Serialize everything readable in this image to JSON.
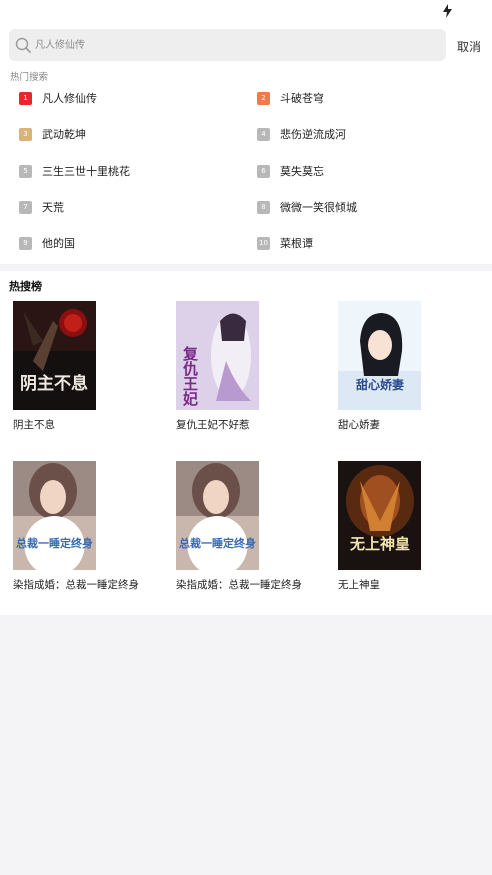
{
  "search": {
    "placeholder": "凡人修仙传",
    "cancel_label": "取消"
  },
  "hot_search": {
    "title": "热门搜索",
    "items": [
      {
        "rank": "1",
        "label": "凡人修仙传",
        "color": "#e8262c"
      },
      {
        "rank": "2",
        "label": "斗破苍穹",
        "color": "#f07a4a"
      },
      {
        "rank": "3",
        "label": "武动乾坤",
        "color": "#d9b27c"
      },
      {
        "rank": "4",
        "label": "悲伤逆流成河",
        "color": "#b8b8b8"
      },
      {
        "rank": "5",
        "label": "三生三世十里桃花",
        "color": "#b8b8b8"
      },
      {
        "rank": "6",
        "label": "莫失莫忘",
        "color": "#b8b8b8"
      },
      {
        "rank": "7",
        "label": "天荒",
        "color": "#b8b8b8"
      },
      {
        "rank": "8",
        "label": "微微一笑很倾城",
        "color": "#b8b8b8"
      },
      {
        "rank": "9",
        "label": "他的国",
        "color": "#b8b8b8"
      },
      {
        "rank": "10",
        "label": "菜根谭",
        "color": "#b8b8b8"
      }
    ]
  },
  "hot_list": {
    "title": "热搜榜",
    "books": [
      {
        "title": "阴主不息",
        "cover_text": "阴主不息"
      },
      {
        "title": "复仇王妃不好惹",
        "cover_text": "复仇王妃"
      },
      {
        "title": "甜心娇妻",
        "cover_text": "甜心娇妻"
      },
      {
        "title": "染指成婚：总裁一睡定终身",
        "cover_text": "总裁一睡定终身"
      },
      {
        "title": "染指成婚：总裁一睡定终身",
        "cover_text": "总裁一睡定终身"
      },
      {
        "title": "无上神皇",
        "cover_text": "无上神皇"
      }
    ]
  }
}
